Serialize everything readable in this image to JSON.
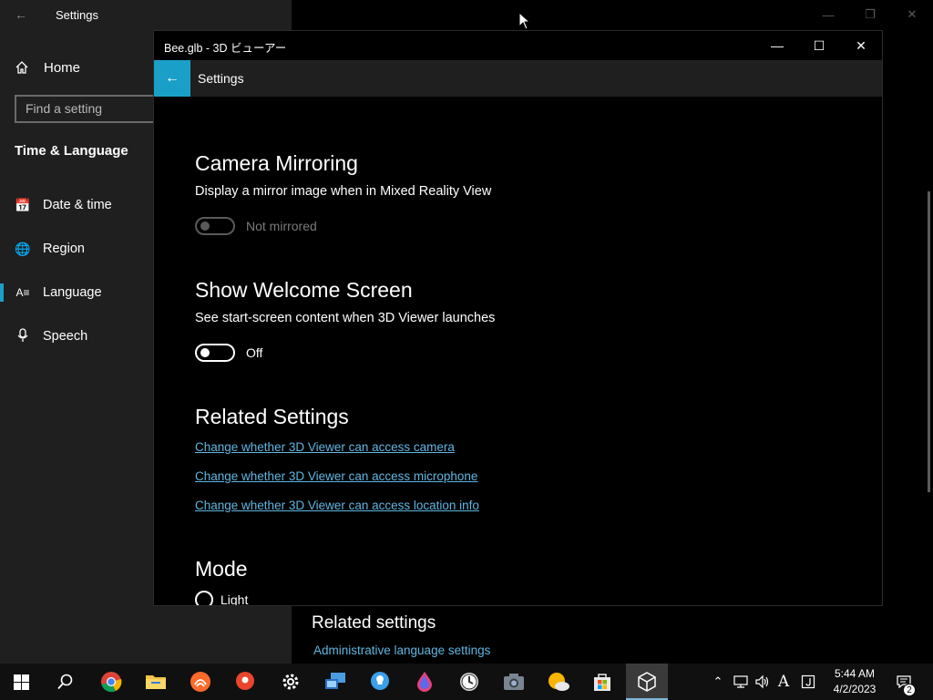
{
  "background_settings": {
    "title": "Settings",
    "home_label": "Home",
    "search_placeholder": "Find a setting",
    "section_title": "Time & Language",
    "nav_items": [
      {
        "label": "Date & time",
        "icon": "calendar-clock-icon"
      },
      {
        "label": "Region",
        "icon": "globe-icon"
      },
      {
        "label": "Language",
        "icon": "language-icon",
        "active": true
      },
      {
        "label": "Speech",
        "icon": "microphone-icon"
      }
    ],
    "related_settings_title": "Related settings",
    "related_link": "Administrative language settings"
  },
  "viewer": {
    "window_title": "Bee.glb - 3D ビューアー",
    "header_title": "Settings",
    "camera_mirroring": {
      "title": "Camera Mirroring",
      "description": "Display a mirror image when in Mixed Reality View",
      "toggle_label": "Not mirrored",
      "toggle_disabled": true
    },
    "welcome_screen": {
      "title": "Show Welcome Screen",
      "description": "See start-screen content when 3D Viewer launches",
      "toggle_label": "Off"
    },
    "related_settings": {
      "title": "Related Settings",
      "links": [
        "Change whether 3D Viewer can access camera",
        "Change whether 3D Viewer can access microphone",
        "Change whether 3D Viewer can access location info"
      ]
    },
    "mode": {
      "title": "Mode",
      "option_light": "Light"
    }
  },
  "taskbar": {
    "apps": [
      "start",
      "search",
      "chrome",
      "file-explorer",
      "sublime",
      "maps",
      "settings",
      "remote-desktop",
      "bulb",
      "paint",
      "clock",
      "camera",
      "weather",
      "store",
      "3d-viewer"
    ],
    "active_app": "3d-viewer",
    "ime_indicator": "A",
    "time": "5:44 AM",
    "date": "4/2/2023",
    "notification_count": "2"
  },
  "colors": {
    "accent": "#1aa0c8",
    "link": "#5fb6e0"
  }
}
